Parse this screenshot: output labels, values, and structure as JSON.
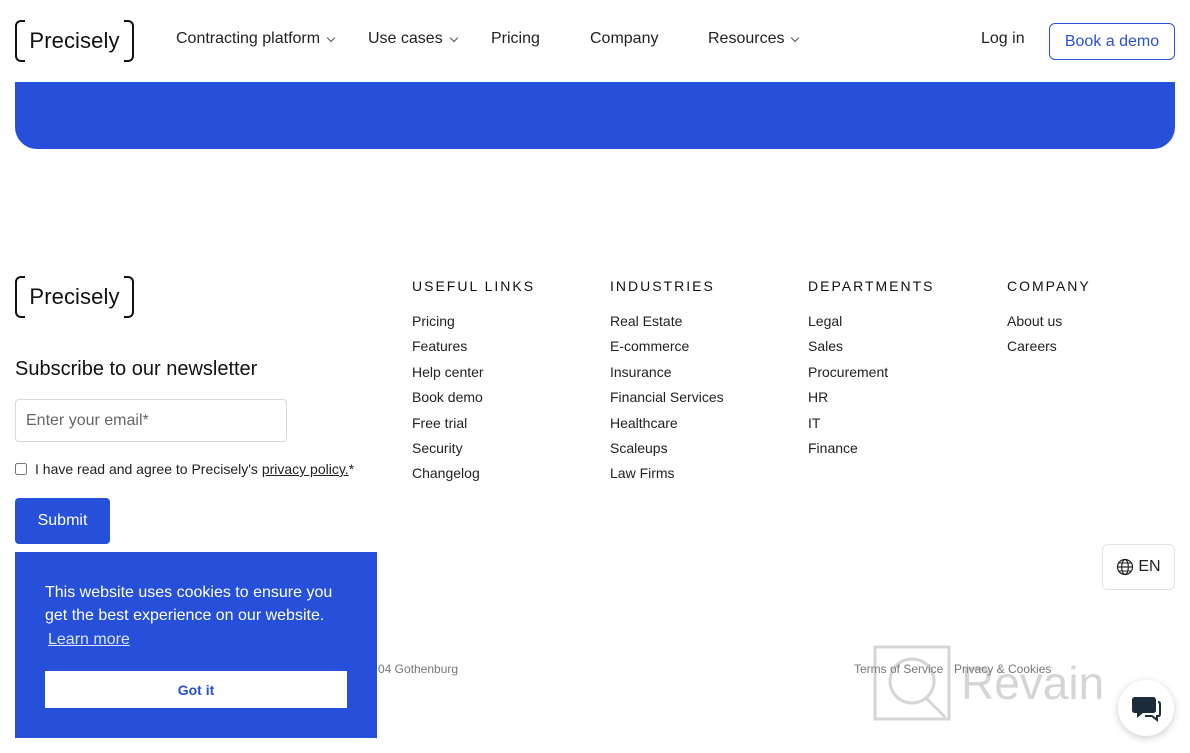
{
  "header": {
    "logo_text": "Precisely",
    "nav": [
      {
        "label": "Contracting platform",
        "has_dropdown": true
      },
      {
        "label": "Use cases",
        "has_dropdown": true
      },
      {
        "label": "Pricing",
        "has_dropdown": false
      },
      {
        "label": "Company",
        "has_dropdown": false
      },
      {
        "label": "Resources",
        "has_dropdown": true
      }
    ],
    "login_label": "Log in",
    "demo_label": "Book a demo"
  },
  "footer": {
    "logo_text": "Precisely",
    "newsletter": {
      "title": "Subscribe to our newsletter",
      "email_placeholder": "Enter your email*",
      "agree_prefix": "I have read and agree to Precisely's ",
      "agree_link": "privacy policy.",
      "agree_suffix": "*",
      "submit_label": "Submit"
    },
    "columns": [
      {
        "title": "USEFUL LINKS",
        "items": [
          "Pricing",
          "Features",
          "Help center",
          "Book demo",
          "Free trial",
          "Security",
          "Changelog"
        ]
      },
      {
        "title": "INDUSTRIES",
        "items": [
          "Real Estate",
          "E-commerce",
          "Insurance",
          "Financial Services",
          "Healthcare",
          "Scaleups",
          "Law Firms"
        ]
      },
      {
        "title": "DEPARTMENTS",
        "items": [
          "Legal",
          "Sales",
          "Procurement",
          "HR",
          "IT",
          "Finance"
        ]
      },
      {
        "title": "COMPANY",
        "items": [
          "About us",
          "Careers"
        ]
      }
    ],
    "language": "EN",
    "address_fragment": "04 Gothenburg",
    "legal_links": [
      "Terms of Service",
      "Privacy & Cookies"
    ]
  },
  "cookie_banner": {
    "message": "This website uses cookies to ensure you get the best experience on our website.",
    "learn_more": "Learn more",
    "accept_label": "Got it"
  },
  "watermark": {
    "text": "Revain"
  },
  "colors": {
    "brand_blue": "#2650d9"
  }
}
